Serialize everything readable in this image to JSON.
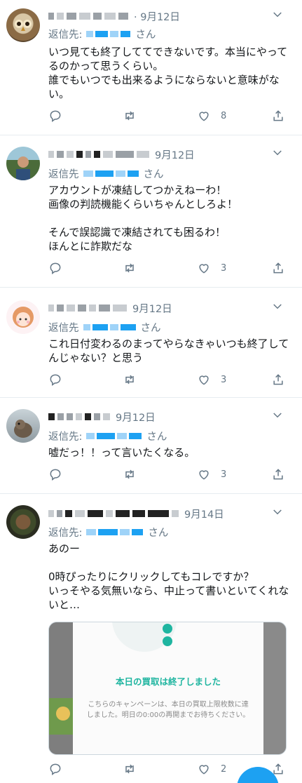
{
  "tweets": [
    {
      "date": "· 9月12日",
      "reply_prefix": "返信先:",
      "reply_suffix": "さん",
      "text": "いつ見ても終了しててできないです。本当にやってるのかって思うくらい。\n誰でもいつでも出来るようにならないと意味がない。",
      "likes": "8",
      "avatar": "owl"
    },
    {
      "date": "9月12日",
      "reply_prefix": "返信先",
      "reply_suffix": "さん",
      "text": "アカウントが凍結してつかえねーわ！\n画像の判読機能くらいちゃんとしろよ！\n\nそんで誤認識で凍結されても困るわ！\nほんとに詐欺だな",
      "likes": "3",
      "avatar": "person"
    },
    {
      "date": "9月12日",
      "reply_prefix": "返信先",
      "reply_suffix": "さん",
      "text": "これ日付変わるのまってやらなきゃいつも終了してんじゃない？と思う",
      "likes": "3",
      "avatar": "girl"
    },
    {
      "date": "9月12日",
      "reply_prefix": "返信先:",
      "reply_suffix": "さん",
      "text": "嘘だっ！！って言いたくなる。",
      "likes": "3",
      "avatar": "squirrel"
    },
    {
      "date": "9月14日",
      "reply_prefix": "返信先:",
      "reply_suffix": "さん",
      "text": "あのー\n\n0時ぴったりにクリックしてもコレですか？\nいっそやる気無いなら、中止って書いといてくれないと…",
      "likes": "2",
      "avatar": "food"
    }
  ],
  "card": {
    "title": "本日の買取は終了しました",
    "body": "こちらのキャンペーンは、本日の買取上限枚数に達しました。明日の0:00の再開までお待ちください。"
  },
  "colors": {
    "accent": "#1da1f2",
    "muted": "#657786",
    "teal": "#1fb5a0"
  },
  "icons": [
    "chevron-down-icon",
    "reply-icon",
    "retweet-icon",
    "like-icon",
    "share-icon"
  ]
}
